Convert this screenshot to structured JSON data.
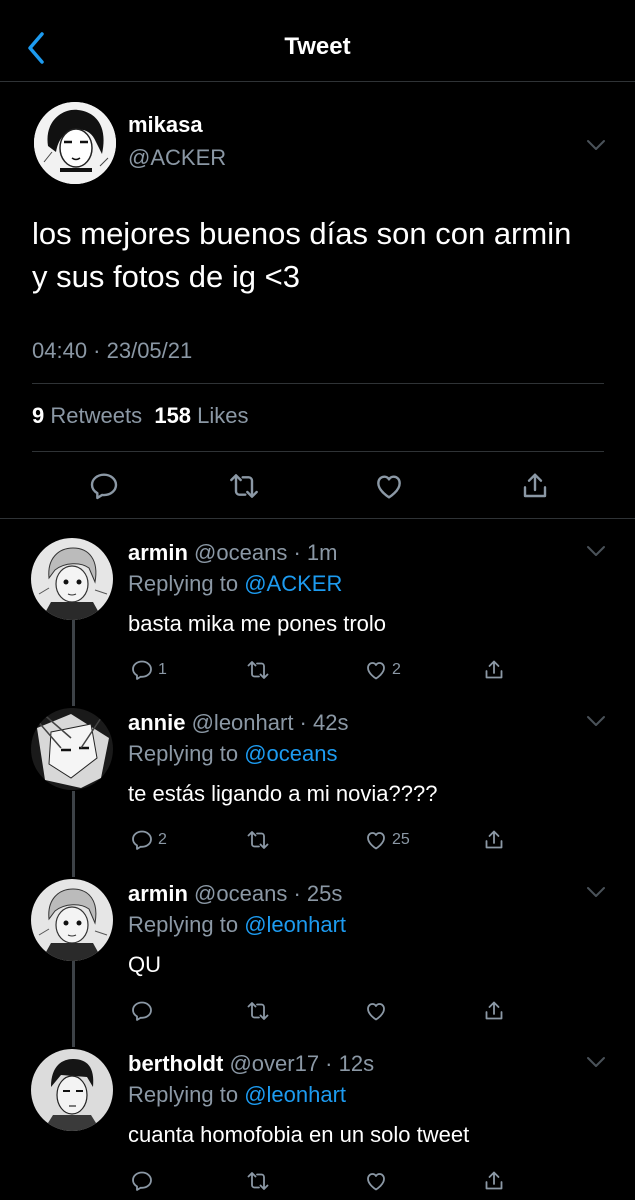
{
  "header": {
    "title": "Tweet",
    "back_icon": "chevron-left-icon"
  },
  "main_tweet": {
    "name": "mikasa",
    "handle": "@ACKER",
    "text": "los mejores buenos días son con armin y sus fotos de ig <3",
    "timestamp": "04:40 · 23/05/21",
    "retweets_count": "9",
    "retweets_label": "Retweets",
    "likes_count": "158",
    "likes_label": "Likes"
  },
  "replies": [
    {
      "name": "armin",
      "handle": "@oceans",
      "age": "1m",
      "replying_prefix": "Replying to",
      "replying_to": "@ACKER",
      "text": "basta mika me pones trolo",
      "reply_count": "1",
      "retweet_count": "",
      "like_count": "2"
    },
    {
      "name": "annie",
      "handle": "@leonhart",
      "age": "42s",
      "replying_prefix": "Replying to",
      "replying_to": "@oceans",
      "text": "te estás ligando a mi novia????",
      "reply_count": "2",
      "retweet_count": "",
      "like_count": "25"
    },
    {
      "name": "armin",
      "handle": "@oceans",
      "age": "25s",
      "replying_prefix": "Replying to",
      "replying_to": "@leonhart",
      "text": "QU",
      "reply_count": "",
      "retweet_count": "",
      "like_count": ""
    },
    {
      "name": "bertholdt",
      "handle": "@over17",
      "age": "12s",
      "replying_prefix": "Replying to",
      "replying_to": "@leonhart",
      "text": "cuanta homofobia en un solo tweet",
      "reply_count": "",
      "retweet_count": "",
      "like_count": ""
    }
  ],
  "colors": {
    "background": "#000000",
    "text": "#ffffff",
    "muted": "#8b98a5",
    "link": "#1d9bf0",
    "divider": "#2f3336"
  }
}
